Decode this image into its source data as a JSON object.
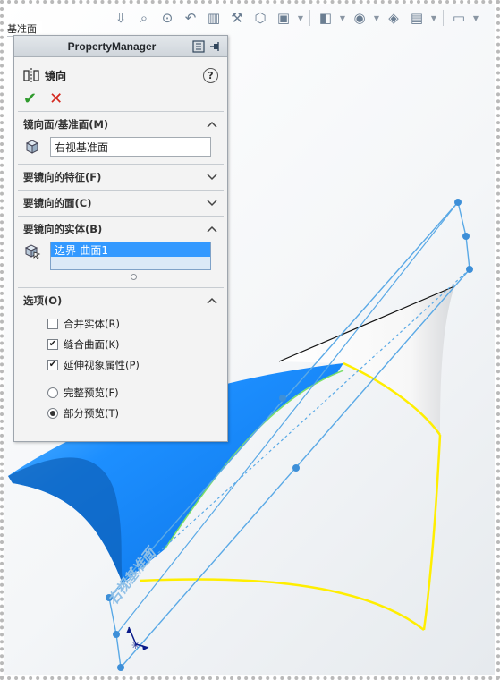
{
  "tree_label": "基准面",
  "toolbar": {
    "icons": [
      "view-orientation-icon",
      "zoom-to-fit-icon",
      "zoom-area-icon",
      "previous-view-icon",
      "section-view-icon",
      "dynamic-annotation-icon",
      "view-cube-icon",
      "display-style-icon",
      "hide-show-icon",
      "edit-appearance-icon",
      "scene-icon",
      "view-settings-icon",
      "monitor-icon"
    ]
  },
  "property_manager": {
    "title": "PropertyManager",
    "feature_name": "镜向",
    "help": "?",
    "mirror_face": {
      "title": "镜向面/基准面(M)",
      "value": "右视基准面"
    },
    "features_to_mirror": {
      "title": "要镜向的特征(F)"
    },
    "faces_to_mirror": {
      "title": "要镜向的面(C)"
    },
    "bodies_to_mirror": {
      "title": "要镜向的实体(B)",
      "items": [
        "边界-曲面1"
      ]
    },
    "options": {
      "title": "选项(O)",
      "merge_solids": {
        "label": "合并实体(R)",
        "checked": false
      },
      "knit_surfaces": {
        "label": "缝合曲面(K)",
        "checked": true
      },
      "propagate_visual": {
        "label": "延伸视象属性(P)",
        "checked": true
      },
      "full_preview": {
        "label": "完整预览(F)",
        "selected": false
      },
      "partial_preview": {
        "label": "部分预览(T)",
        "selected": true
      }
    }
  },
  "canvas": {
    "plane_label": "右视基准面",
    "colors": {
      "surface": "#1e90ff",
      "preview_edge": "#ffee00",
      "plane_edge": "#5aa9e6",
      "handle": "#3d8fd8"
    }
  }
}
